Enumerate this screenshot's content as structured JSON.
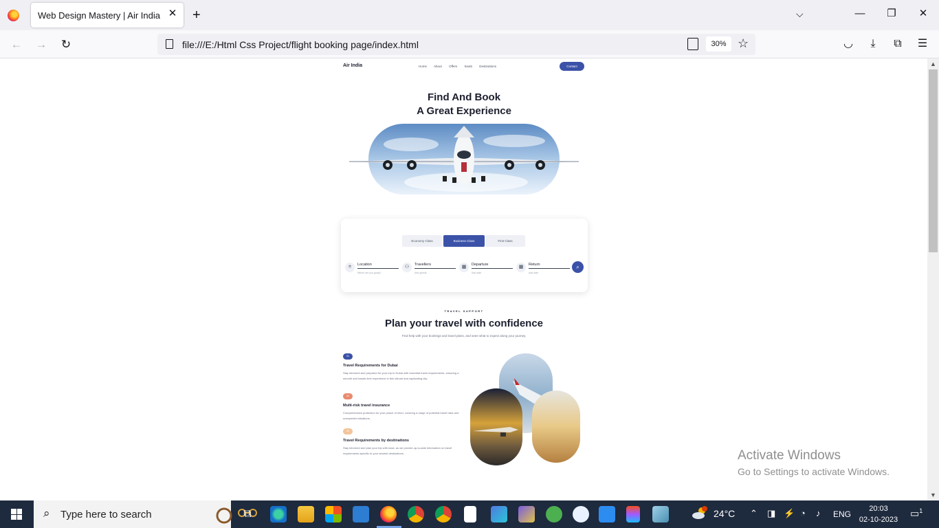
{
  "browser": {
    "tab_title": "Web Design Mastery | Air India",
    "url": "file:///E:/Html Css Project/flight booking page/index.html",
    "zoom": "30%"
  },
  "site": {
    "logo": "Air India",
    "nav": [
      "Home",
      "About",
      "Offers",
      "Seats",
      "Destinations"
    ],
    "contact_label": "Contact",
    "hero_line1": "Find And Book",
    "hero_line2": "A Great Experience",
    "classes": [
      "Economy Class",
      "Business Class",
      "First Class"
    ],
    "fields": [
      {
        "label": "Location",
        "hint": "Where are you going?"
      },
      {
        "label": "Travellers",
        "hint": "Add guests"
      },
      {
        "label": "Departure",
        "hint": "Add date"
      },
      {
        "label": "Return",
        "hint": "Add date"
      }
    ],
    "overline": "TRAVEL SUPPORT",
    "section_title": "Plan your travel with confidence",
    "section_sub": "Find help with your bookings and travel plans, and seee what to expect along your journey.",
    "features": [
      {
        "num": "01",
        "color": "#3b52a8",
        "title": "Travel Requirements for Dubai",
        "text": "Stay informed and prepared for your trip to Dubai with essential travel requirements, ensuring a smooth and hassle-free experience in this vibrant and captivating city."
      },
      {
        "num": "02",
        "color": "#e98a6f",
        "title": "Multi-risk travel insurance",
        "text": "Comprehensive protection for your peace of mind, covering a range of potential travel risks and unexpected situations."
      },
      {
        "num": "03",
        "color": "#f4c49a",
        "title": "Travel Requirements by destinations",
        "text": "Stay informed and plan your trip with ease, as we provide up-to-date information on travel requirements specific to your desired destinations."
      }
    ]
  },
  "watermark": {
    "line1": "Activate Windows",
    "line2": "Go to Settings to activate Windows."
  },
  "taskbar": {
    "search_placeholder": "Type here to search",
    "temperature": "24°C",
    "language": "ENG",
    "time": "20:03",
    "date": "02-10-2023",
    "notification_count": "1"
  }
}
